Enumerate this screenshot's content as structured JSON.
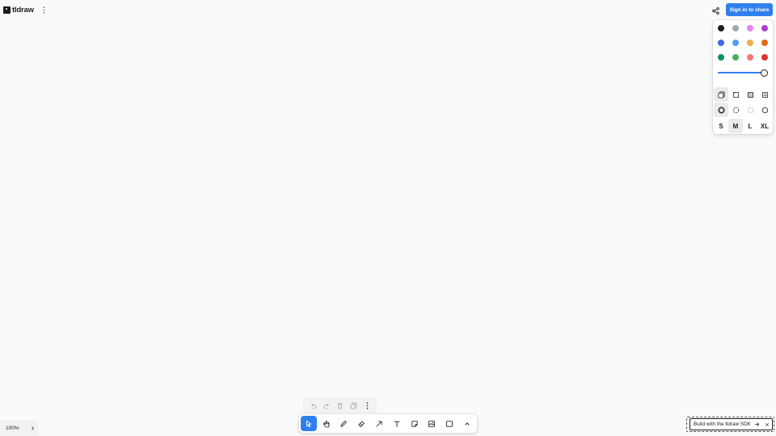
{
  "app": {
    "logo_text": "tldraw",
    "logo_icon": "tldraw-logo-icon",
    "main_menu_icon": "more-vertical-icon"
  },
  "share": {
    "share_icon": "share-icon",
    "sign_in_label": "Sign in to share"
  },
  "style_panel": {
    "colors": [
      {
        "name": "black",
        "hex": "#1d1d1d",
        "selected": true
      },
      {
        "name": "grey",
        "hex": "#9fa8b2"
      },
      {
        "name": "light-violet",
        "hex": "#e085f4"
      },
      {
        "name": "violet",
        "hex": "#ae3ec9"
      },
      {
        "name": "blue",
        "hex": "#4465e9"
      },
      {
        "name": "light-blue",
        "hex": "#4ba1f1"
      },
      {
        "name": "yellow",
        "hex": "#f1ac4b"
      },
      {
        "name": "orange",
        "hex": "#e16919"
      },
      {
        "name": "green",
        "hex": "#099268"
      },
      {
        "name": "light-green",
        "hex": "#4cb05e"
      },
      {
        "name": "light-red",
        "hex": "#f87777"
      },
      {
        "name": "red",
        "hex": "#e03131"
      }
    ],
    "opacity": 1.0,
    "fill_options": [
      {
        "name": "fill-none-icon",
        "selected": true
      },
      {
        "name": "fill-semi-icon"
      },
      {
        "name": "fill-solid-icon"
      },
      {
        "name": "fill-pattern-icon"
      }
    ],
    "dash_options": [
      {
        "name": "dash-draw-icon",
        "selected": true
      },
      {
        "name": "dash-dashed-icon"
      },
      {
        "name": "dash-dotted-icon"
      },
      {
        "name": "dash-solid-icon"
      }
    ],
    "sizes": [
      {
        "label": "S"
      },
      {
        "label": "M",
        "selected": true
      },
      {
        "label": "L"
      },
      {
        "label": "XL"
      }
    ]
  },
  "quick_actions": [
    {
      "name": "undo-icon"
    },
    {
      "name": "redo-icon"
    },
    {
      "name": "trash-icon"
    },
    {
      "name": "duplicate-icon"
    },
    {
      "name": "more-vertical-icon"
    }
  ],
  "toolbar": [
    {
      "name": "select-tool-icon",
      "active": true
    },
    {
      "name": "hand-tool-icon"
    },
    {
      "name": "draw-tool-icon"
    },
    {
      "name": "eraser-tool-icon"
    },
    {
      "name": "arrow-tool-icon"
    },
    {
      "name": "text-tool-icon"
    },
    {
      "name": "note-tool-icon"
    },
    {
      "name": "asset-tool-icon"
    },
    {
      "name": "rectangle-tool-icon"
    },
    {
      "name": "chevron-up-icon"
    }
  ],
  "zoom": {
    "label": "100%",
    "minimap_icon": "chevron-right-icon"
  },
  "sdk_banner": {
    "text": "Build with the tldraw SDK",
    "arrow_icon": "arrow-right-icon",
    "close_icon": "close-icon"
  },
  "theme": {
    "accent": "#2f80ed",
    "canvas": "#f9fafb",
    "panel": "#ffffff"
  }
}
